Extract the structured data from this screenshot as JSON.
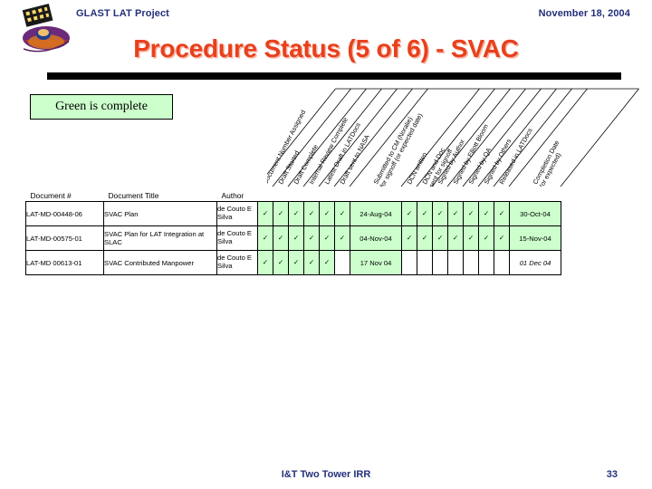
{
  "header": {
    "project": "GLAST LAT Project",
    "date": "November 18, 2004",
    "title": "Procedure Status (5 of 6) - SVAC",
    "logo_icon": "glast-satellite-logo"
  },
  "legend": {
    "text": "Green is complete",
    "color": "#ccffcc"
  },
  "colors": {
    "title": "#E8401C",
    "header_text": "#24307a",
    "complete_green": "#ccffcc",
    "rule_bar": "#000000"
  },
  "table": {
    "lead_columns": [
      "Document #",
      "Document Title",
      "Author"
    ],
    "rotated_columns": [
      "Document Number Assigned",
      "Draft Started",
      "Draft Complete",
      "Internal Review Complete",
      "Latest Draft in LATDocs",
      "Draft sent to NASA",
      "Submitted to CM (Noralie) for signoff (or expected date)",
      "DCN written",
      "DCN and Doc sent for signoff",
      "Signed by Author",
      "Signed by Elliott Bloom",
      "Signed by QA",
      "Signed by Others",
      "Released in LATDocs",
      "Completion Date (or expected)"
    ],
    "check_glyph": "✓",
    "rows": [
      {
        "doc": "LAT-MD-00448-06",
        "title": "SVAC Plan",
        "author": "de Couto E Silva",
        "cells": [
          {
            "type": "check",
            "green": true
          },
          {
            "type": "check",
            "green": true
          },
          {
            "type": "check",
            "green": true
          },
          {
            "type": "check",
            "green": true
          },
          {
            "type": "check",
            "green": true
          },
          {
            "type": "check",
            "green": true
          },
          {
            "type": "date",
            "value": "24-Aug-04",
            "green": true,
            "italic": false
          },
          {
            "type": "check",
            "green": true
          },
          {
            "type": "check",
            "green": true
          },
          {
            "type": "check",
            "green": true
          },
          {
            "type": "check",
            "green": true
          },
          {
            "type": "check",
            "green": true
          },
          {
            "type": "check",
            "green": true
          },
          {
            "type": "check",
            "green": true
          },
          {
            "type": "date",
            "value": "30-Oct-04",
            "green": true,
            "italic": false
          }
        ]
      },
      {
        "doc": "LAT-MD-00575-01",
        "title": "SVAC Plan for LAT Integration at SLAC",
        "author": "de Couto E Silva",
        "cells": [
          {
            "type": "check",
            "green": true
          },
          {
            "type": "check",
            "green": true
          },
          {
            "type": "check",
            "green": true
          },
          {
            "type": "check",
            "green": true
          },
          {
            "type": "check",
            "green": true
          },
          {
            "type": "check",
            "green": true
          },
          {
            "type": "date",
            "value": "04-Nov-04",
            "green": true,
            "italic": false
          },
          {
            "type": "check",
            "green": true
          },
          {
            "type": "check",
            "green": true
          },
          {
            "type": "check",
            "green": true
          },
          {
            "type": "check",
            "green": true
          },
          {
            "type": "check",
            "green": true
          },
          {
            "type": "check",
            "green": true
          },
          {
            "type": "check",
            "green": true
          },
          {
            "type": "date",
            "value": "15-Nov-04",
            "green": true,
            "italic": false
          }
        ]
      },
      {
        "doc": "LAT-MD 00613-01",
        "title": "SVAC Contributed Manpower",
        "author": "de Couto E Silva",
        "cells": [
          {
            "type": "check",
            "green": true
          },
          {
            "type": "check",
            "green": true
          },
          {
            "type": "check",
            "green": true
          },
          {
            "type": "check",
            "green": true
          },
          {
            "type": "check",
            "green": true
          },
          {
            "type": "empty",
            "green": false
          },
          {
            "type": "date",
            "value": "17 Nov 04",
            "green": true,
            "italic": false
          },
          {
            "type": "empty",
            "green": false
          },
          {
            "type": "empty",
            "green": false
          },
          {
            "type": "empty",
            "green": false
          },
          {
            "type": "empty",
            "green": false
          },
          {
            "type": "empty",
            "green": false
          },
          {
            "type": "empty",
            "green": false
          },
          {
            "type": "empty",
            "green": false
          },
          {
            "type": "date",
            "value": "01 Dec 04",
            "green": false,
            "italic": true
          }
        ]
      }
    ]
  },
  "footer": {
    "center": "I&T Two Tower IRR",
    "page": "33"
  }
}
